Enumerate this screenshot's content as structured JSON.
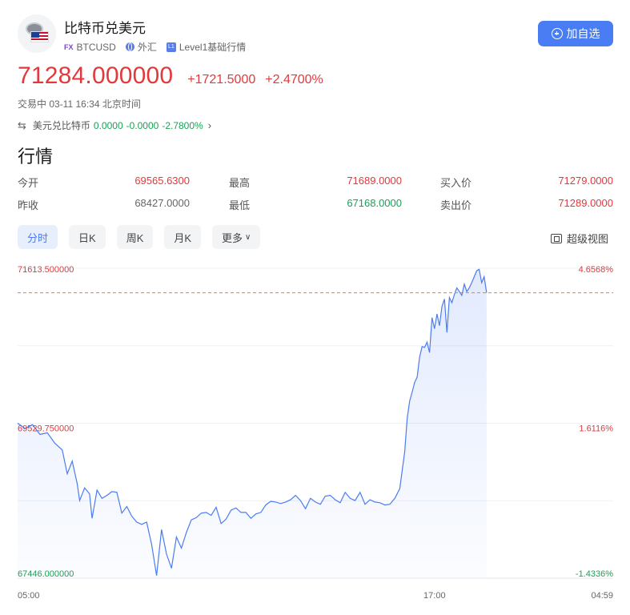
{
  "header": {
    "title": "比特币兑美元",
    "tags": [
      {
        "badge": "FX",
        "text": "BTCUSD"
      },
      {
        "badge": "globe-icon",
        "text": "外汇"
      },
      {
        "badge": "L1",
        "text": "Level1基础行情"
      }
    ],
    "add_button_label": "加自选"
  },
  "quote": {
    "price": "71284.000000",
    "change": "+1721.5000",
    "change_pct": "+2.4700%",
    "status": "交易中 03-11 16:34 北京时间"
  },
  "inverse": {
    "label": "美元兑比特币",
    "price": "0.0000",
    "change": "-0.0000",
    "change_pct": "-2.7800%"
  },
  "section_title": "行情",
  "stats": [
    [
      {
        "label": "今开",
        "value": "69565.6300",
        "color": "red"
      },
      {
        "label": "最高",
        "value": "71689.0000",
        "color": "red"
      },
      {
        "label": "买入价",
        "value": "71279.0000",
        "color": "red"
      }
    ],
    [
      {
        "label": "昨收",
        "value": "68427.0000",
        "color": "gray"
      },
      {
        "label": "最低",
        "value": "67168.0000",
        "color": "green"
      },
      {
        "label": "卖出价",
        "value": "71289.0000",
        "color": "red"
      }
    ]
  ],
  "tabs": [
    "分时",
    "日K",
    "周K",
    "月K",
    "更多"
  ],
  "active_tab": 0,
  "super_view_label": "超级视图",
  "colors": {
    "up": "#e2393c",
    "down": "#1aa156",
    "accent": "#4a7cf3",
    "line": "#4a7cf3"
  },
  "chart_data": {
    "type": "area",
    "y_left_ticks": [
      "71613.500000",
      "69529.750000",
      "67446.000000"
    ],
    "y_right_ticks": [
      "4.6568%",
      "1.6116%",
      "-1.4336%"
    ],
    "x_ticks": [
      "05:00",
      "17:00",
      "04:59"
    ],
    "ylim": [
      67446.0,
      71613.5
    ],
    "x_range_hours": [
      0,
      24
    ],
    "reference_price": 71284.0,
    "series": [
      {
        "x": [
          0,
          0.3,
          0.6,
          0.9,
          1.2,
          1.5,
          1.8,
          2.0,
          2.2,
          2.4,
          2.5,
          2.7,
          2.9,
          3.0,
          3.2,
          3.4,
          3.6,
          3.8,
          4.0,
          4.2,
          4.4,
          4.6,
          4.8,
          5.0,
          5.2,
          5.4,
          5.6,
          5.8,
          6.0,
          6.2,
          6.4,
          6.6,
          6.8,
          7.0,
          7.2,
          7.4,
          7.6,
          7.8,
          8.0,
          8.2,
          8.4,
          8.6,
          8.8,
          9.0,
          9.2,
          9.4,
          9.6,
          9.8,
          10.0,
          10.2,
          10.4,
          10.6,
          10.8,
          11.0,
          11.2,
          11.4,
          11.6,
          11.8,
          12.0,
          12.2,
          12.4,
          12.6,
          12.8,
          13.0,
          13.2,
          13.4,
          13.6,
          13.8,
          14.0,
          14.2,
          14.4,
          14.6,
          14.8,
          15.0,
          15.2,
          15.4,
          15.5,
          15.6,
          15.7,
          15.8,
          15.9,
          16.0,
          16.1,
          16.2,
          16.3,
          16.4,
          16.5,
          16.6,
          16.7,
          16.8,
          16.9,
          17.0,
          17.1,
          17.2,
          17.3,
          17.4,
          17.5,
          17.6,
          17.7,
          17.8,
          17.9,
          18.0,
          18.1,
          18.2,
          18.3,
          18.4,
          18.5,
          18.6,
          18.7,
          18.8,
          18.9
        ],
        "y": [
          69530,
          69460,
          69510,
          69380,
          69400,
          69260,
          69170,
          68850,
          69020,
          68720,
          68490,
          68660,
          68580,
          68250,
          68630,
          68520,
          68560,
          68610,
          68600,
          68320,
          68410,
          68280,
          68200,
          68170,
          68200,
          67900,
          67480,
          68100,
          67770,
          67580,
          68000,
          67850,
          68060,
          68230,
          68260,
          68320,
          68330,
          68290,
          68400,
          68180,
          68240,
          68360,
          68390,
          68330,
          68330,
          68250,
          68310,
          68330,
          68430,
          68480,
          68470,
          68450,
          68470,
          68500,
          68560,
          68490,
          68380,
          68520,
          68470,
          68440,
          68550,
          68560,
          68500,
          68460,
          68600,
          68520,
          68490,
          68600,
          68440,
          68500,
          68470,
          68460,
          68430,
          68440,
          68520,
          68650,
          68900,
          69150,
          69600,
          69830,
          69950,
          70080,
          70150,
          70420,
          70560,
          70550,
          70620,
          70480,
          70950,
          70800,
          71000,
          70840,
          71100,
          71200,
          70750,
          71220,
          71150,
          71260,
          71350,
          71300,
          71250,
          71400,
          71300,
          71350,
          71420,
          71500,
          71580,
          71600,
          71420,
          71500,
          71284
        ]
      }
    ]
  }
}
